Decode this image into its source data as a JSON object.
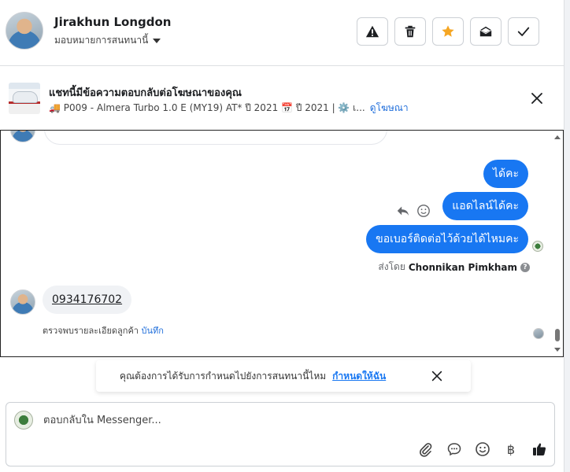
{
  "header": {
    "contact_name": "Jirakhun Longdon",
    "assign_label": "มอบหมายการสนทนานี้",
    "actions": [
      {
        "name": "mark-spam-button",
        "icon": "warning-icon"
      },
      {
        "name": "delete-button",
        "icon": "trash-icon"
      },
      {
        "name": "star-button",
        "icon": "star-icon"
      },
      {
        "name": "mark-unread-button",
        "icon": "envelope-open-icon"
      },
      {
        "name": "mark-done-button",
        "icon": "check-icon"
      }
    ]
  },
  "ad_banner": {
    "title": "แชทนี้มีข้อความตอบกลับต่อโฆษณาของคุณ",
    "subtitle": "🚚 P009 - Almera Turbo 1.0 E (MY19) AT* ปี 2021 📅 ปี 2021 | ⚙️ เ...",
    "view_ad_label": "ดูโฆษณา"
  },
  "conversation": {
    "outgoing": [
      {
        "text": "ได้คะ"
      },
      {
        "text": "แอดไลน์ได้คะ"
      },
      {
        "text": "ขอเบอร์ติดต่อไว้ด้วยได้ไหมคะ"
      }
    ],
    "sent_by_prefix": "ส่งโดย",
    "sent_by_name": "Chonnikan Pimkham",
    "incoming": {
      "text": "0934176702"
    },
    "customer_note_prefix": "ตรวจพบรายละเอียดลูกค้า",
    "customer_note_action": "บันทึก"
  },
  "suggestion": {
    "text": "คุณต้องการได้รับการกำหนดไปยังการสนทนานี้ไหม",
    "action": "กำหนดให้ฉัน"
  },
  "composer": {
    "placeholder": "ตอบกลับใน Messenger...",
    "currency_symbol": "฿"
  },
  "colors": {
    "accent": "#1877f2",
    "star": "#f5a623",
    "link": "#216fdb"
  }
}
